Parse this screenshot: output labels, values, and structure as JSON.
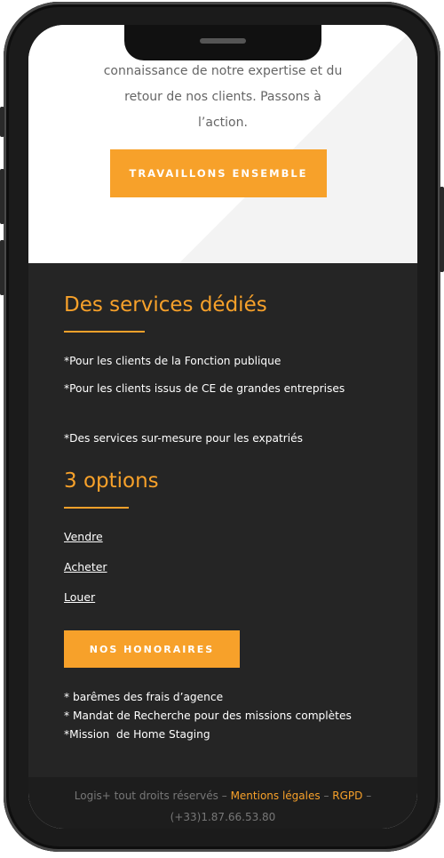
{
  "hero": {
    "text_line1": "connaissance de notre expertise et du",
    "text_line2": "retour de nos clients. Passons à",
    "text_line3": "l’action.",
    "cta_label": "TRAVAILLONS ENSEMBLE"
  },
  "services": {
    "title": "Des services dédiés",
    "items": [
      "*Pour les clients de la Fonction publique",
      "*Pour les clients issus de CE de grandes entreprises",
      "*Des services sur-mesure pour les expatriés"
    ]
  },
  "options": {
    "title": "3 options",
    "links": [
      "Vendre",
      "Acheter",
      "Louer"
    ],
    "fees_button": "NOS HONORAIRES",
    "notes": [
      "* barêmes des frais d’agence",
      "* Mandat de Recherche pour des missions complètes",
      "*Mission  de Home Staging"
    ]
  },
  "footer": {
    "copyright": "Logis+ tout droits réservés",
    "sep1": " – ",
    "legal_link": "Mentions légales",
    "sep2": " – ",
    "rgpd_link": "RGPD",
    "sep3": " –",
    "phone": "(+33)1.87.66.53.80"
  },
  "colors": {
    "accent": "#f7a12a",
    "dark_bg": "#252525",
    "footer_bg": "#1d1d1d"
  }
}
